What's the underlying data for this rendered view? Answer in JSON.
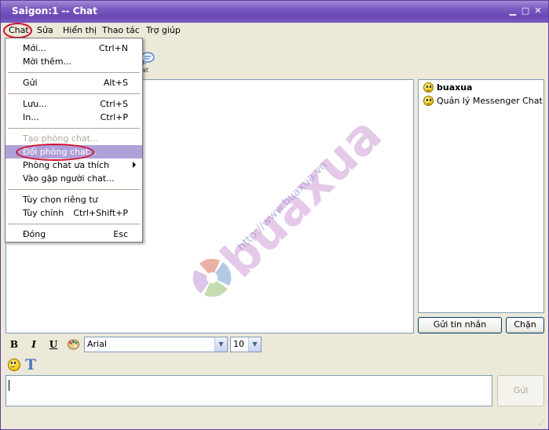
{
  "window": {
    "title": "Saigon:1 -- Chat"
  },
  "menubar": {
    "items": [
      {
        "label": "Chat"
      },
      {
        "label": "Sửa"
      },
      {
        "label": "Hiển thị"
      },
      {
        "label": "Thao tác"
      },
      {
        "label": "Trợ giúp"
      }
    ]
  },
  "toolbar": {
    "partial_label": "at"
  },
  "chat_menu": {
    "items": [
      {
        "label": "Mới...",
        "shortcut": "Ctrl+N"
      },
      {
        "label": "Mời thêm...",
        "shortcut": ""
      },
      {
        "label": "Gửi",
        "shortcut": "Alt+S"
      },
      {
        "label": "Lưu...",
        "shortcut": "Ctrl+S"
      },
      {
        "label": "In...",
        "shortcut": "Ctrl+P"
      },
      {
        "label": "Tạo phòng chat...",
        "shortcut": "",
        "disabled": true
      },
      {
        "label": "Đổi phòng chat...",
        "shortcut": "",
        "highlighted": true
      },
      {
        "label": "Phòng chat ưa thích",
        "shortcut": "",
        "submenu": true
      },
      {
        "label": "Vào gặp người chat...",
        "shortcut": ""
      },
      {
        "label": "Tùy chọn riêng tư",
        "shortcut": ""
      },
      {
        "label": "Tùy chỉnh",
        "shortcut": "Ctrl+Shift+P"
      },
      {
        "label": "Đóng",
        "shortcut": "Esc"
      }
    ]
  },
  "watermark": {
    "url": "http://www.buaxua.vn",
    "brand": "buaxua"
  },
  "users": [
    {
      "name": "buaxua",
      "bold": true,
      "icon": "smiley-icon"
    },
    {
      "name": "Quản lý Messenger Chat",
      "bold": false,
      "icon": "smiley-icon"
    }
  ],
  "buttons": {
    "send_message": "Gửi tin nhắn",
    "block": "Chặn",
    "send": "Gửi"
  },
  "format": {
    "bold": "B",
    "italic": "I",
    "underline": "U",
    "font": "Arial",
    "size": "10",
    "text_style": "T"
  },
  "colors": {
    "title_bar": "#7d5bc2",
    "menu_highlight": "#b19fd8",
    "annotation_red": "#d0102a"
  }
}
